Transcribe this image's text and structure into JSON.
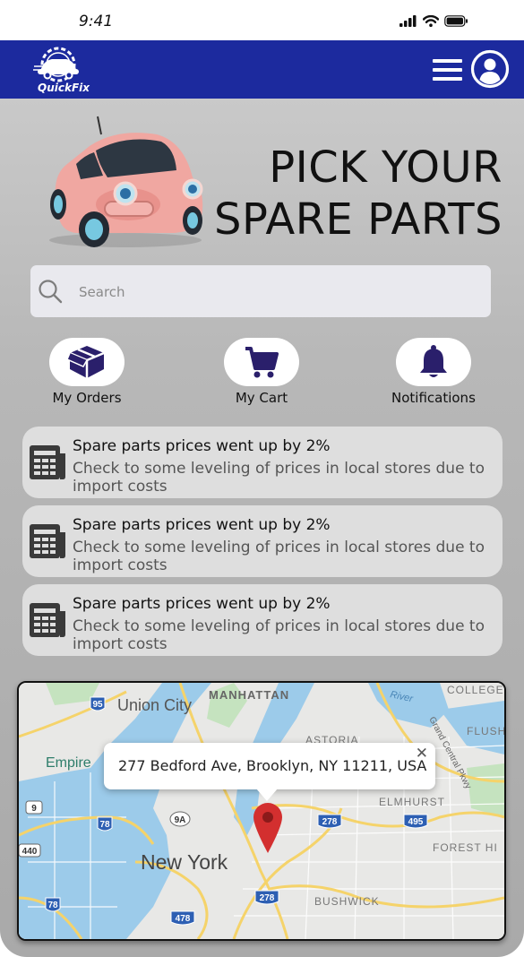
{
  "status_bar": {
    "time": "9:41"
  },
  "header": {
    "logo_text": "QuickFix"
  },
  "hero": {
    "title_line1": "PICK YOUR",
    "title_line2": "SPARE PARTS"
  },
  "search": {
    "placeholder": "Search"
  },
  "quick_actions": [
    {
      "label": "My Orders",
      "icon": "box-icon"
    },
    {
      "label": "My Cart",
      "icon": "cart-icon"
    },
    {
      "label": "Notifications",
      "icon": "bell-icon"
    }
  ],
  "news": [
    {
      "title": "Spare parts prices went up by 2%",
      "body": "Check to some leveling of prices in local stores due to import costs",
      "icon": "newspaper-icon"
    },
    {
      "title": "Spare parts prices went up by 2%",
      "body": "Check to some leveling of prices in local stores due to import costs",
      "icon": "newspaper-icon"
    },
    {
      "title": "Spare parts prices went up by 2%",
      "body": "Check to some leveling of prices in local stores due to import costs",
      "icon": "newspaper-icon"
    }
  ],
  "map": {
    "address": "277 Bedford Ave, Brooklyn, NY 11211, USA",
    "labels": {
      "union_city": "Union City",
      "manhattan": "MANHATTAN",
      "astoria": "ASTORIA",
      "empire": "Empire",
      "elmhurst": "ELMHURST",
      "forest_hills": "FOREST HI",
      "new_york": "New York",
      "bushwick": "BUSHWICK",
      "college": "COLLEGE",
      "flush": "FLUSH",
      "river": "River",
      "parkway": "Grand Central Pkwy"
    },
    "shields": {
      "i95": "95",
      "r9a": "9A",
      "i78a": "78",
      "i78b": "78",
      "i278a": "278",
      "i278b": "278",
      "i495": "495",
      "i478": "478",
      "r9": "9",
      "r440": "440"
    }
  },
  "colors": {
    "header": "#1c2a9e",
    "accent_icon": "#2a1f6b",
    "pin": "#d32f2f"
  }
}
